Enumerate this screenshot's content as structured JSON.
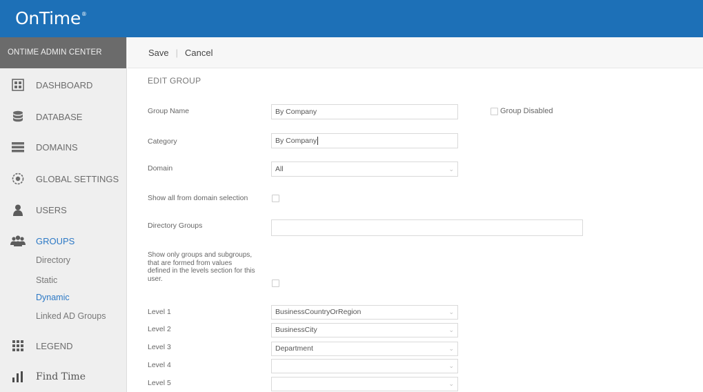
{
  "app": {
    "logo": "OnTime",
    "logo_mark": "®"
  },
  "sidebar": {
    "header": "ONTIME ADMIN CENTER",
    "items": [
      {
        "label": "DASHBOARD",
        "icon": "dashboard-icon"
      },
      {
        "label": "DATABASE",
        "icon": "database-icon"
      },
      {
        "label": "DOMAINS",
        "icon": "domains-icon"
      },
      {
        "label": "GLOBAL SETTINGS",
        "icon": "globe-icon"
      },
      {
        "label": "USERS",
        "icon": "user-icon"
      },
      {
        "label": "GROUPS",
        "icon": "groups-icon",
        "active": true
      },
      {
        "label": "LEGEND",
        "icon": "legend-grid-icon"
      },
      {
        "label": "Find Time",
        "icon": "bar-chart-icon"
      }
    ],
    "groups_sub": [
      "Directory",
      "Static",
      "Dynamic",
      "Linked AD Groups"
    ],
    "active_sub": "Dynamic"
  },
  "toolbar": {
    "save_label": "Save",
    "separator": "|",
    "cancel_label": "Cancel"
  },
  "form": {
    "title": "EDIT GROUP",
    "group_name_label": "Group Name",
    "group_name_value": "By Company",
    "group_disabled_label": "Group Disabled",
    "category_label": "Category",
    "category_value": "By Company",
    "domain_label": "Domain",
    "domain_value": "All",
    "show_all_label": "Show all from domain selection",
    "directory_groups_label": "Directory Groups",
    "directory_groups_value": "",
    "show_only_label_lines": [
      "Show only groups and subgroups,",
      "that are formed from values",
      "defined in the levels section for this",
      "user."
    ],
    "levels": [
      {
        "label": "Level 1",
        "value": "BusinessCountryOrRegion"
      },
      {
        "label": "Level 2",
        "value": "BusinessCity"
      },
      {
        "label": "Level 3",
        "value": "Department"
      },
      {
        "label": "Level 4",
        "value": ""
      },
      {
        "label": "Level 5",
        "value": ""
      }
    ]
  },
  "colors": {
    "topbar": "#1d70b7",
    "admin_header": "#6b6b6b",
    "sidebar": "#efefef",
    "active": "#2b78c5"
  }
}
